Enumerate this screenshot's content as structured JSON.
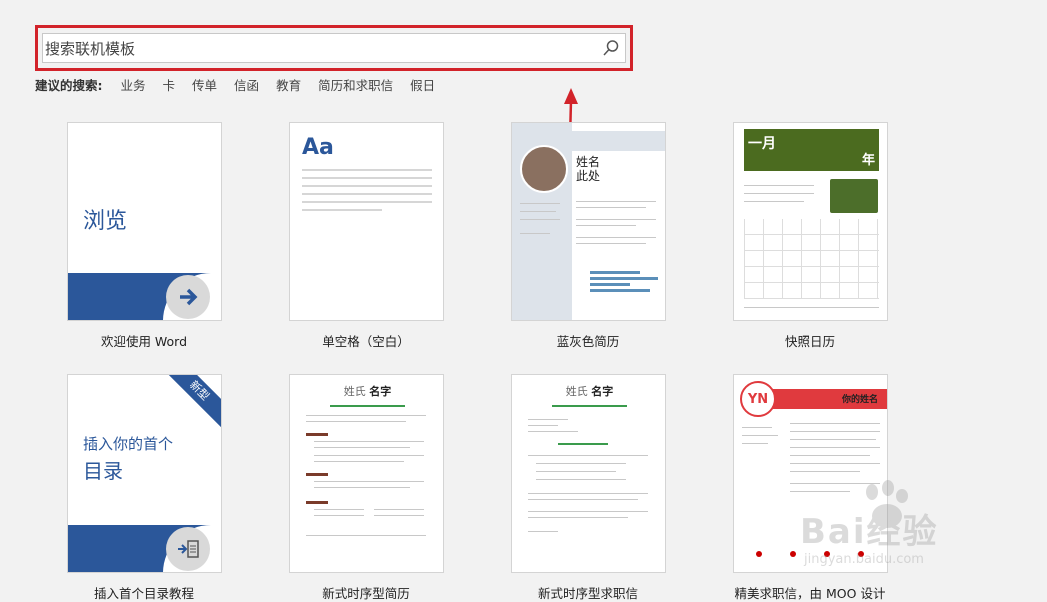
{
  "search": {
    "placeholder": "搜索联机模板",
    "icon": "search-icon"
  },
  "suggestions": {
    "label": "建议的搜索:",
    "keywords": [
      "业务",
      "卡",
      "传单",
      "信函",
      "教育",
      "简历和求职信",
      "假日"
    ]
  },
  "templates": [
    {
      "label": "欢迎使用 Word",
      "thumb_text": "浏览"
    },
    {
      "label": "单空格（空白）",
      "thumb_text": "Aa"
    },
    {
      "label": "蓝灰色简历",
      "name_line1": "姓名",
      "name_line2": "此处"
    },
    {
      "label": "快照日历",
      "month": "一月",
      "year": "年"
    },
    {
      "label": "插入首个目录教程",
      "badge": "新型",
      "line1": "插入你的首个",
      "line2": "目录"
    },
    {
      "label": "新式时序型简历",
      "surname": "姓氏",
      "given": "名字"
    },
    {
      "label": "新式时序型求职信",
      "surname": "姓氏",
      "given": "名字"
    },
    {
      "label": "精美求职信，由 MOO 设计",
      "initials": "YN",
      "name": "你的姓名"
    }
  ],
  "colors": {
    "accent": "#2b579a",
    "highlight": "#d2232a",
    "calendar_header": "#4b6b1f",
    "moo_red": "#e03a3e"
  },
  "watermark": {
    "text": "Bai经验",
    "url": "jingyan.baidu.com"
  }
}
